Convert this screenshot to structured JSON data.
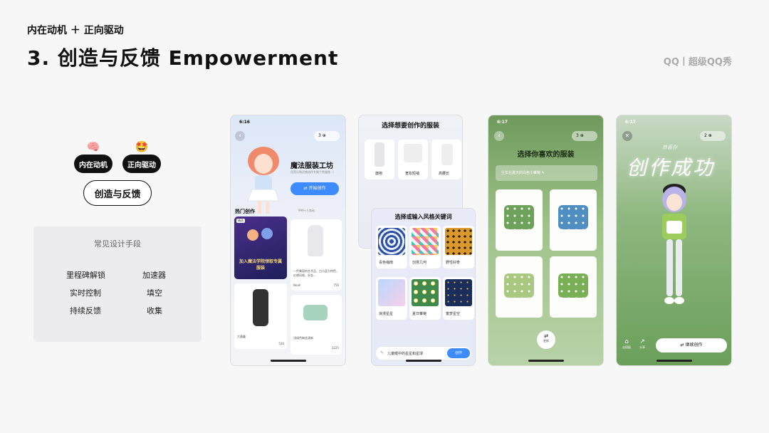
{
  "header": {
    "kicker": "内在动机 ＋ 正向驱动",
    "title": "3. 创造与反馈 Empowerment",
    "brand": "QQ丨超级QQ秀"
  },
  "left": {
    "chip1": {
      "label": "内在动机",
      "emoji": "🧠"
    },
    "chip2": {
      "label": "正向驱动",
      "emoji": "🤩"
    },
    "pill": "创造与反馈",
    "card_title": "常见设计手段",
    "techniques": [
      "里程碑解锁",
      "加速器",
      "实时控制",
      "填空",
      "持续反馈",
      "收集"
    ]
  },
  "phone1": {
    "time": "6:16",
    "count": "3",
    "title": "魔法服装工坊",
    "subtitle": "用音乐和灵感创作专属个性服装 ⓘ",
    "button": "⇄ 开始创作",
    "section": "热门创作",
    "section_meta": "999+人皆动",
    "caption1": "一件美丽的艺术品，白与蓝为特色，幻想风格，异金...",
    "author1": "Noah",
    "likes1": "756",
    "name2": "大墨鑫",
    "likes2": "536",
    "name3": "浅绿色梅花清新",
    "likes3": "3225",
    "badge": "精选",
    "poster": "加入魔法学院领取专属服装"
  },
  "phone2": {
    "title": "选择想要创作的服装",
    "garments": [
      "旗袍",
      "宽松短袖",
      "高腰长"
    ],
    "style_title": "选择或输入风格关键词",
    "styles": [
      "青色缩南",
      "创意几何",
      "野性好奇",
      "浪漫星星",
      "夏日雏菊",
      "童梦星空"
    ],
    "input_placeholder": "儿童眼中的星星和星球",
    "input_button": "创作"
  },
  "phone3": {
    "time": "6:17",
    "count": "3",
    "title": "选择你喜欢的服装",
    "prompt": "生长在夏天的白色小雏菊 ✎",
    "switch": "更换"
  },
  "phone4": {
    "time": "6:17",
    "count": "2",
    "script": "创作成功",
    "subscript": "恭喜你",
    "btn_left1": "去搭配",
    "btn_left2": "分享",
    "cta": "⇄ 继续创作"
  },
  "colors": {
    "accent": "#3d8bfd",
    "green": "#8fb86a"
  }
}
